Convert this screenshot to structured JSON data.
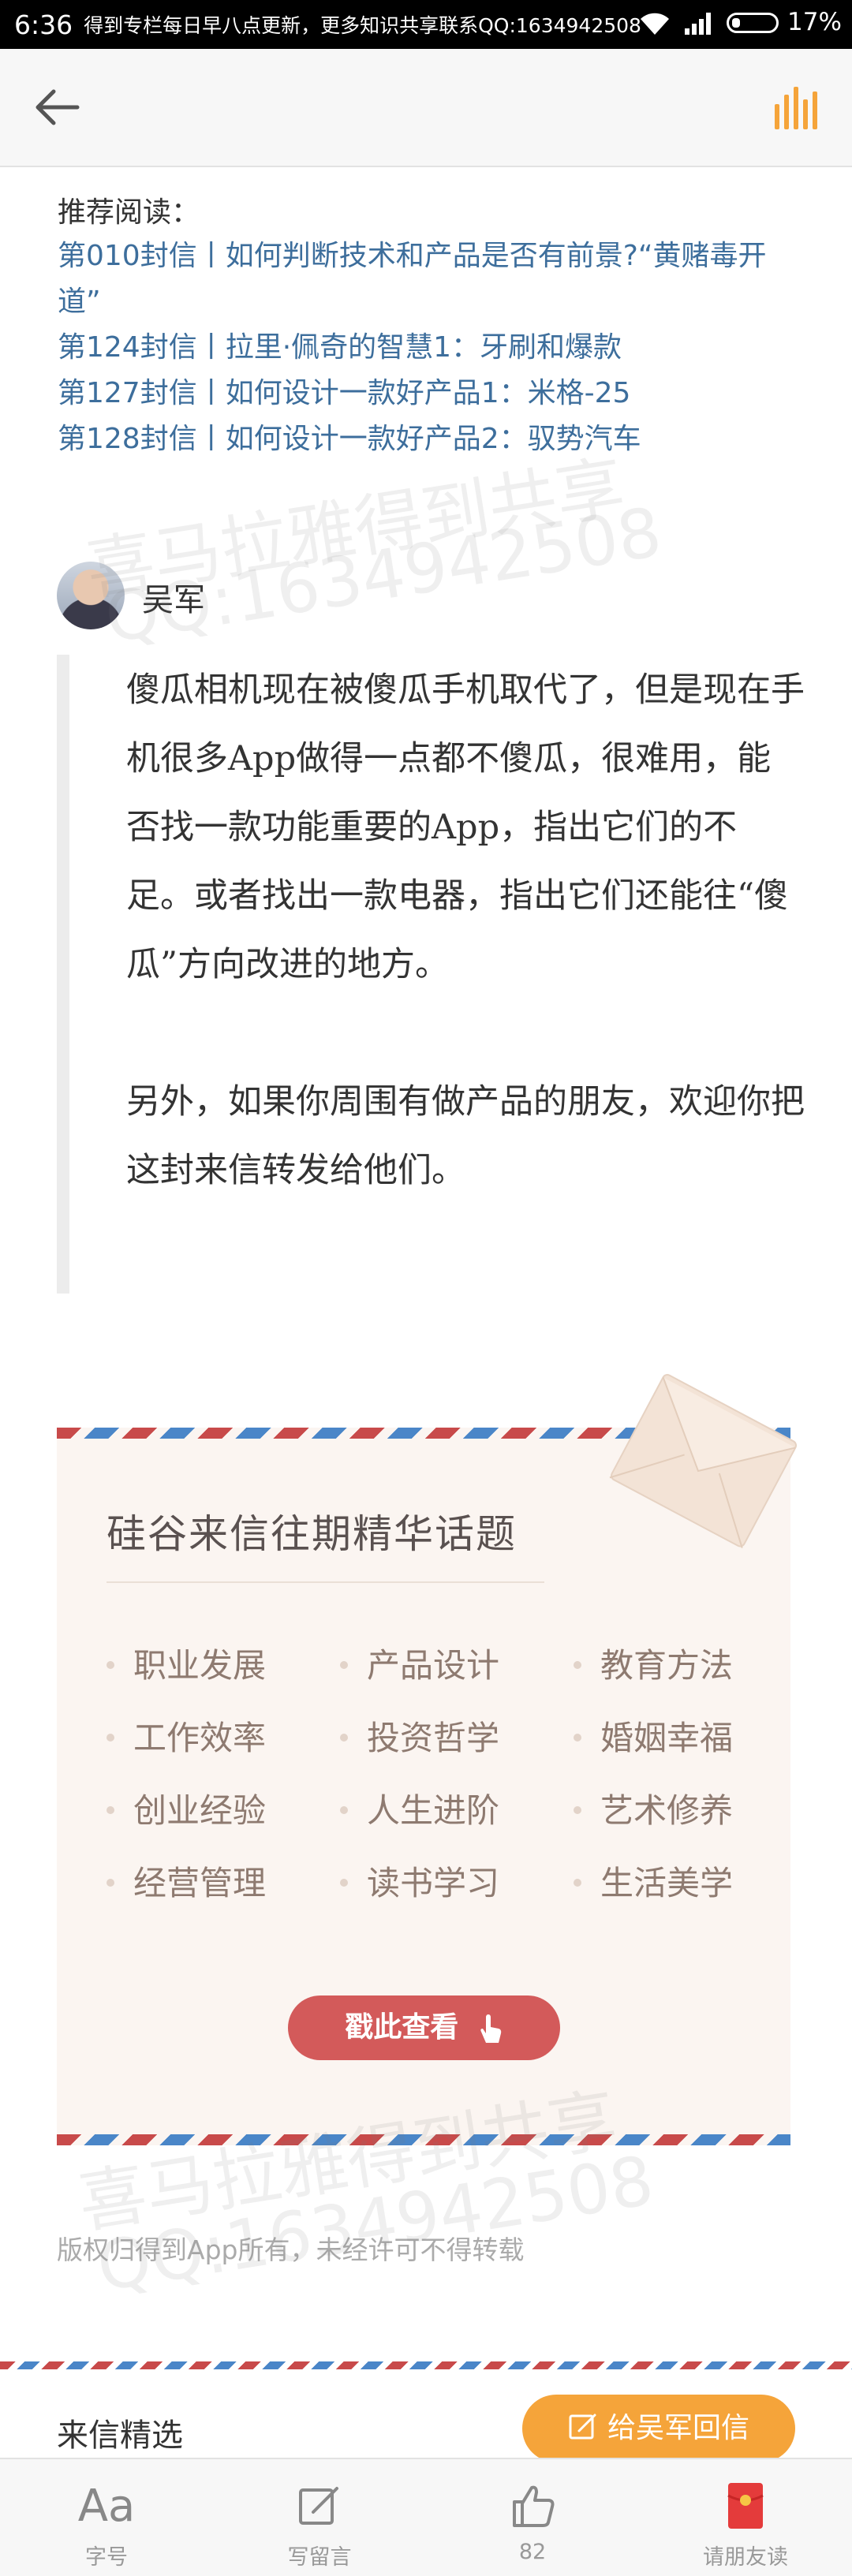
{
  "status_bar": {
    "time": "6:36",
    "notice": "得到专栏每日早八点更新，更多知识共享联系QQ:1634942508",
    "battery": "17%"
  },
  "recommended": {
    "title": "推荐阅读：",
    "items": [
      "第010封信丨如何判断技术和产品是否有前景?“黄赌毒开道”",
      "第124封信丨拉里·佩奇的智慧1：牙刷和爆款",
      "第127封信丨如何设计一款好产品1：米格-25",
      "第128封信丨如何设计一款好产品2：驭势汽车"
    ]
  },
  "author": {
    "name": "吴军"
  },
  "quote": {
    "paragraphs": [
      "傻瓜相机现在被傻瓜手机取代了，但是现在手机很多App做得一点都不傻瓜，很难用，能否找一款功能重要的App，指出它们的不足。或者找出一款电器，指出它们还能往“傻瓜”方向改进的地方。",
      "另外，如果你周围有做产品的朋友，欢迎你把这封来信转发给他们。"
    ]
  },
  "promo": {
    "title": "硅谷来信往期精华话题",
    "topics": [
      "职业发展",
      "产品设计",
      "教育方法",
      "工作效率",
      "投资哲学",
      "婚姻幸福",
      "创业经验",
      "人生进阶",
      "艺术修养",
      "经营管理",
      "读书学习",
      "生活美学"
    ],
    "cta": "戳此查看"
  },
  "copyright": "版权归得到App所有，未经许可不得转载",
  "selected": {
    "title": "来信精选",
    "reply_button": "给吴军回信"
  },
  "toolbar": {
    "font_glyph": "Aa",
    "font_label": "字号",
    "comment_label": "写留言",
    "like_count": "82",
    "invite_label": "请朋友读"
  },
  "watermark": {
    "line1": "喜马拉雅得到共享",
    "line2": "QQ:1634942508"
  },
  "colors": {
    "link": "#3d6e9c",
    "accent_orange": "#f5a43a",
    "cta_red": "#d35a5a",
    "envelope_bg": "#fbf5f1"
  }
}
